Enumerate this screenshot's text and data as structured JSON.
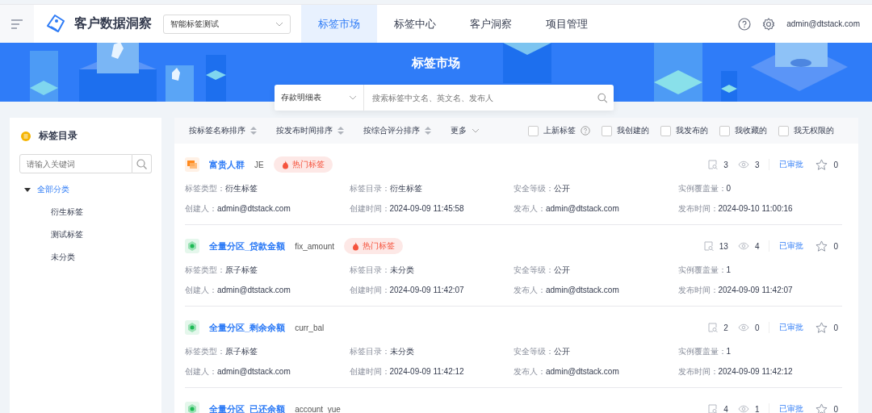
{
  "header": {
    "title": "客户数据洞察",
    "project_select": {
      "value": "智能标签测试"
    },
    "tabs": [
      {
        "label": "标签市场",
        "selected": true
      },
      {
        "label": "标签中心",
        "selected": false
      },
      {
        "label": "客户洞察",
        "selected": false
      },
      {
        "label": "项目管理",
        "selected": false
      }
    ],
    "user": "admin@dtstack.com"
  },
  "banner": {
    "title": "标签市场",
    "source_select": {
      "value": "存款明细表"
    },
    "search": {
      "placeholder": "搜索标签中文名、英文名、发布人"
    }
  },
  "sidebar": {
    "title": "标签目录",
    "search": {
      "placeholder": "请输入关键词"
    },
    "tree": [
      {
        "label": "全部分类",
        "expanded": true,
        "children": [
          {
            "label": "衍生标签"
          },
          {
            "label": "测试标签"
          },
          {
            "label": "未分类"
          }
        ]
      }
    ]
  },
  "toolbar": {
    "sorts": [
      "按标签名称排序",
      "按发布时间排序",
      "按综合评分排序"
    ],
    "more": "更多",
    "filters": [
      {
        "label": "上新标签",
        "checked": false,
        "help": true
      },
      {
        "label": "我创建的",
        "checked": false,
        "help": false
      },
      {
        "label": "我发布的",
        "checked": false,
        "help": false
      },
      {
        "label": "我收藏的",
        "checked": false,
        "help": false
      },
      {
        "label": "我无权限的",
        "checked": false,
        "help": false
      }
    ]
  },
  "tags": [
    {
      "kind": "derived",
      "name": "富贵人群",
      "code": "JE",
      "hot": true,
      "hot_label": "热门标签",
      "uses": "3",
      "views": "3",
      "status": "已审批",
      "favorites": "0",
      "fields": [
        {
          "label": "标签类型：",
          "value": "衍生标签"
        },
        {
          "label": "标签目录：",
          "value": "衍生标签"
        },
        {
          "label": "安全等级：",
          "value": "公开"
        },
        {
          "label": "实例覆盖量：",
          "value": "0"
        },
        {
          "label": "创建人：",
          "value": "admin@dtstack.com"
        },
        {
          "label": "创建时间：",
          "value": "2024-09-09 11:45:58"
        },
        {
          "label": "发布人：",
          "value": "admin@dtstack.com"
        },
        {
          "label": "发布时间：",
          "value": "2024-09-10 11:00:16"
        }
      ]
    },
    {
      "kind": "atomic",
      "name": "全量分区_贷款金额",
      "code": "fix_amount",
      "hot": true,
      "hot_label": "热门标签",
      "uses": "13",
      "views": "4",
      "status": "已审批",
      "favorites": "0",
      "fields": [
        {
          "label": "标签类型：",
          "value": "原子标签"
        },
        {
          "label": "标签目录：",
          "value": "未分类"
        },
        {
          "label": "安全等级：",
          "value": "公开"
        },
        {
          "label": "实例覆盖量：",
          "value": "1"
        },
        {
          "label": "创建人：",
          "value": "admin@dtstack.com"
        },
        {
          "label": "创建时间：",
          "value": "2024-09-09 11:42:07"
        },
        {
          "label": "发布人：",
          "value": "admin@dtstack.com"
        },
        {
          "label": "发布时间：",
          "value": "2024-09-09 11:42:07"
        }
      ]
    },
    {
      "kind": "atomic",
      "name": "全量分区_剩余余额",
      "code": "curr_bal",
      "hot": false,
      "uses": "2",
      "views": "0",
      "status": "已审批",
      "favorites": "0",
      "fields": [
        {
          "label": "标签类型：",
          "value": "原子标签"
        },
        {
          "label": "标签目录：",
          "value": "未分类"
        },
        {
          "label": "安全等级：",
          "value": "公开"
        },
        {
          "label": "实例覆盖量：",
          "value": "1"
        },
        {
          "label": "创建人：",
          "value": "admin@dtstack.com"
        },
        {
          "label": "创建时间：",
          "value": "2024-09-09 11:42:12"
        },
        {
          "label": "发布人：",
          "value": "admin@dtstack.com"
        },
        {
          "label": "发布时间：",
          "value": "2024-09-09 11:42:12"
        }
      ]
    },
    {
      "kind": "atomic",
      "name": "全量分区_已还余额",
      "code": "account_yue",
      "hot": false,
      "uses": "4",
      "views": "1",
      "status": "已审批",
      "favorites": "0"
    }
  ]
}
